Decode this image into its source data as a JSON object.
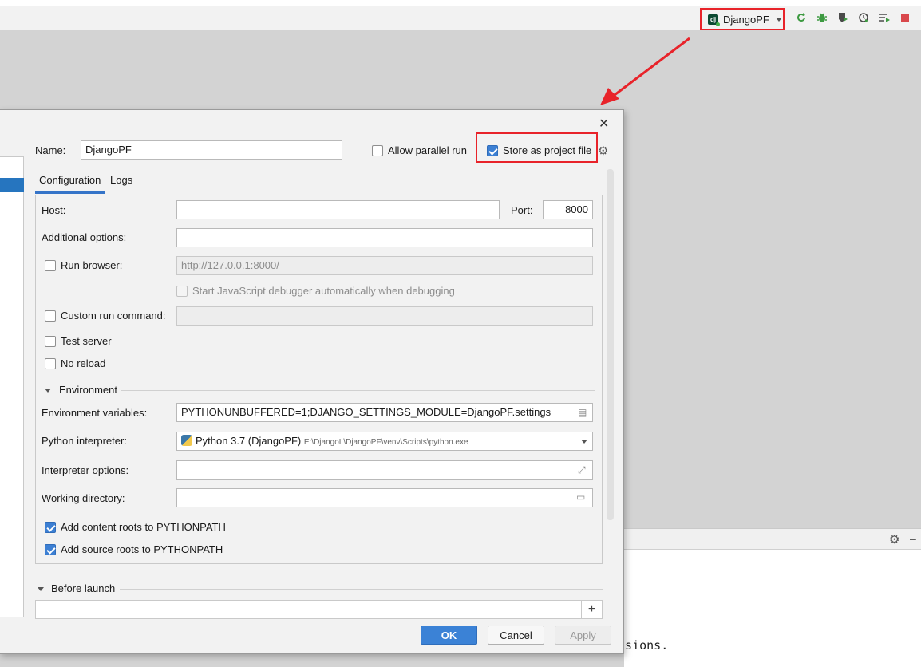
{
  "toolbar": {
    "run_config_label": "DjangoPF",
    "django_icon_glyph": "dj",
    "icons": [
      "rerun-icon",
      "debug-icon",
      "coverage-icon",
      "profile-icon",
      "run-concurrency-icon",
      "stop-icon"
    ]
  },
  "dialog": {
    "name_label": "Name:",
    "name_value": "DjangoPF",
    "allow_parallel_label": "Allow parallel run",
    "store_project_label": "Store as project file",
    "tabs": [
      "Configuration",
      "Logs"
    ],
    "host_label": "Host:",
    "host_value": "",
    "port_label": "Port:",
    "port_value": "8000",
    "additional_options_label": "Additional options:",
    "additional_options_value": "",
    "run_browser_label": "Run browser:",
    "run_browser_url": "http://127.0.0.1:8000/",
    "js_debugger_label": "Start JavaScript debugger automatically when debugging",
    "custom_run_label": "Custom run command:",
    "custom_run_value": "",
    "test_server_label": "Test server",
    "no_reload_label": "No reload",
    "environment_label": "Environment",
    "env_vars_label": "Environment variables:",
    "env_vars_value": "PYTHONUNBUFFERED=1;DJANGO_SETTINGS_MODULE=DjangoPF.settings",
    "interpreter_label": "Python interpreter:",
    "interpreter_name": "Python 3.7 (DjangoPF)",
    "interpreter_path": "E:\\DjangoL\\DjangoPF\\venv\\Scripts\\python.exe",
    "interpreter_options_label": "Interpreter options:",
    "interpreter_options_value": "",
    "working_dir_label": "Working directory:",
    "working_dir_value": "",
    "content_roots_label": "Add content roots to PYTHONPATH",
    "source_roots_label": "Add source roots to PYTHONPATH",
    "before_launch_label": "Before launch",
    "ok_label": "OK",
    "cancel_label": "Cancel",
    "apply_label": "Apply",
    "close_glyph": "✕",
    "plus_glyph": "+"
  },
  "console": {
    "text": "essions."
  },
  "colors": {
    "highlight_border": "#e8232a",
    "accent": "#3b82d6"
  }
}
